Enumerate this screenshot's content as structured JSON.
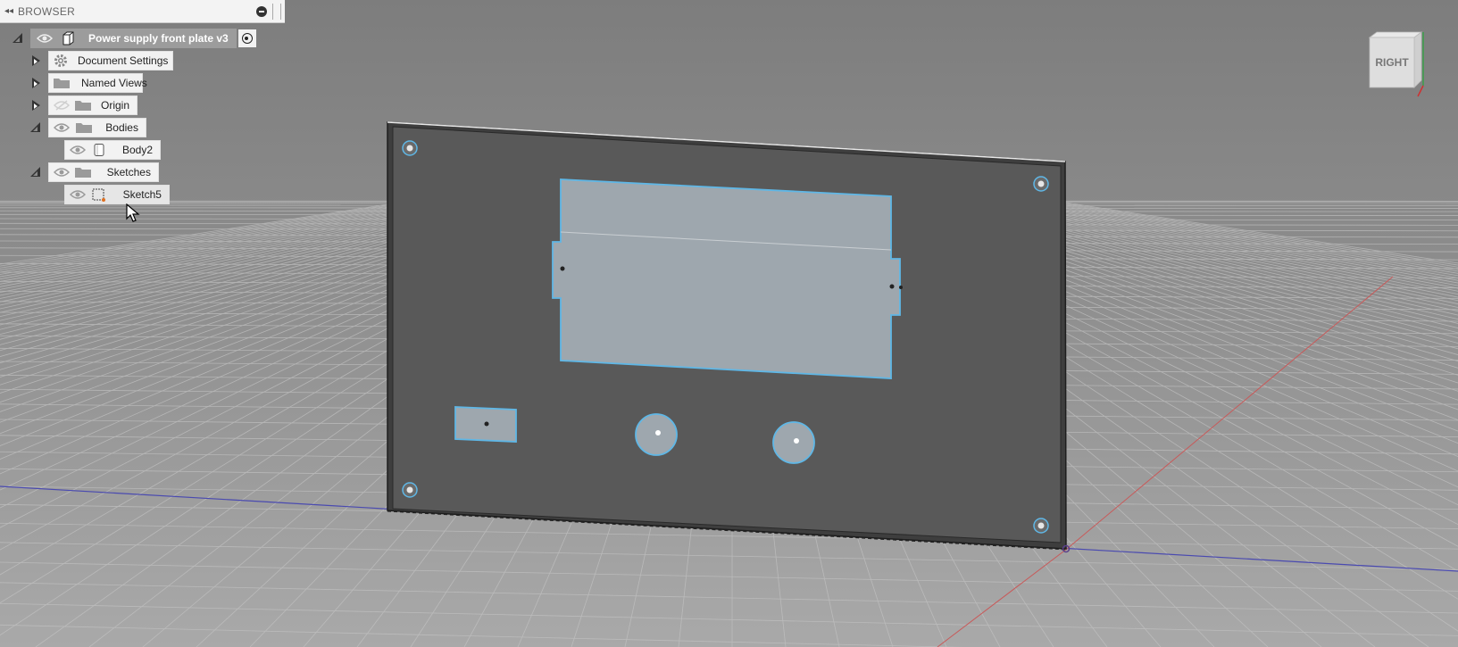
{
  "browser": {
    "title": "BROWSER",
    "root": {
      "label": "Power supply front plate v3"
    },
    "items": [
      {
        "label": "Document Settings",
        "expander": "closed",
        "icon": "gear-icon"
      },
      {
        "label": "Named Views",
        "expander": "closed",
        "icon": "folder-icon"
      },
      {
        "label": "Origin",
        "expander": "closed",
        "icon": "folder-icon"
      },
      {
        "label": "Bodies",
        "expander": "open",
        "icon": "folder-icon"
      },
      {
        "label": "Body2",
        "icon": "body-icon"
      },
      {
        "label": "Sketches",
        "expander": "open",
        "icon": "folder-icon"
      },
      {
        "label": "Sketch5",
        "icon": "sketch-icon"
      }
    ]
  },
  "viewcube": {
    "face_label": "RIGHT"
  },
  "colors": {
    "viewport_bg": "#8a8a8a",
    "plate_face": "#595959",
    "cutout_fill": "#9aa3ab",
    "sketch_line": "#5fb7e6",
    "x_axis": "#c85a5a",
    "z_axis": "#4a4ab0",
    "grid": "#bdbdbd"
  }
}
